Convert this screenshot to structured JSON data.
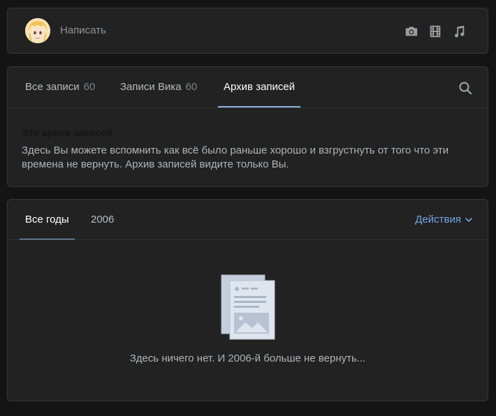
{
  "composer": {
    "placeholder": "Написать",
    "icons": [
      "camera-icon",
      "video-icon",
      "music-icon"
    ]
  },
  "wall_tabs": {
    "items": [
      {
        "label": "Все записи",
        "count": "60",
        "active": false
      },
      {
        "label": "Записи Вика",
        "count": "60",
        "active": false
      },
      {
        "label": "Архив записей",
        "count": "",
        "active": true
      }
    ],
    "search_icon": "search-icon"
  },
  "archive_info": {
    "title": "Это архив записей",
    "text": "Здесь Вы можете вспомнить как всё было раньше хорошо и взгрустнуть от того что эти времена не вернуть. Архив записей видите только Вы."
  },
  "archive": {
    "year_tabs": [
      {
        "label": "Все годы",
        "active": true
      },
      {
        "label": "2006",
        "active": false
      }
    ],
    "actions_label": "Действия",
    "empty_text": "Здесь ничего нет. И 2006-й больше не вернуть..."
  },
  "colors": {
    "background": "#141414",
    "card": "#222222",
    "accent": "#72a7e3",
    "active_underline": "#8fb3e0"
  }
}
